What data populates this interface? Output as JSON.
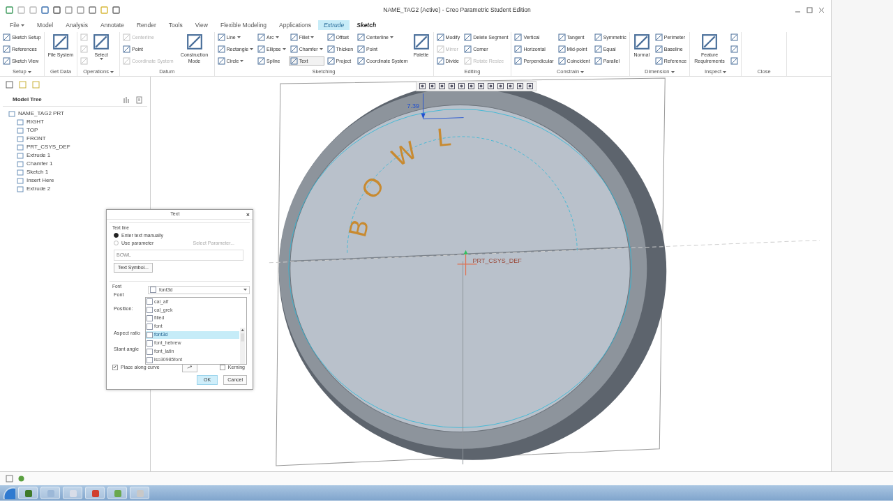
{
  "window": {
    "title": "NAME_TAG2 (Active) - Creo Parametric Student Edition"
  },
  "tabs": [
    {
      "label": "File",
      "dropdown": true,
      "highlighted": false,
      "selected": false
    },
    {
      "label": "Model",
      "dropdown": false,
      "highlighted": false,
      "selected": false
    },
    {
      "label": "Analysis",
      "dropdown": false,
      "highlighted": false,
      "selected": false
    },
    {
      "label": "Annotate",
      "dropdown": false,
      "highlighted": false,
      "selected": false
    },
    {
      "label": "Render",
      "dropdown": false,
      "highlighted": false,
      "selected": false
    },
    {
      "label": "Tools",
      "dropdown": false,
      "highlighted": false,
      "selected": false
    },
    {
      "label": "View",
      "dropdown": false,
      "highlighted": false,
      "selected": false
    },
    {
      "label": "Flexible Modeling",
      "dropdown": false,
      "highlighted": false,
      "selected": false
    },
    {
      "label": "Applications",
      "dropdown": false,
      "highlighted": false,
      "selected": false
    },
    {
      "label": "Extrude",
      "dropdown": false,
      "highlighted": true,
      "selected": false
    },
    {
      "label": "Sketch",
      "dropdown": false,
      "highlighted": false,
      "selected": true
    }
  ],
  "ribbon": [
    {
      "label": "Setup",
      "dropdown": true,
      "columns": [
        [
          {
            "kind": "small",
            "label": "Sketch Setup",
            "disabled": false,
            "dropdown": false,
            "pressed": false
          },
          {
            "kind": "small",
            "label": "References",
            "disabled": false,
            "dropdown": false,
            "pressed": false
          },
          {
            "kind": "small",
            "label": "Sketch View",
            "disabled": false,
            "dropdown": false,
            "pressed": false
          }
        ]
      ]
    },
    {
      "label": "Get Data",
      "dropdown": false,
      "columns": [
        [
          {
            "kind": "large",
            "label": "File System",
            "disabled": false,
            "dropdown": false,
            "pressed": false
          }
        ]
      ]
    },
    {
      "label": "Operations",
      "dropdown": true,
      "columns": [
        [
          {
            "kind": "icon",
            "disabled": true,
            "dropdown": false,
            "pressed": false
          },
          {
            "kind": "icon",
            "disabled": true,
            "dropdown": false,
            "pressed": false
          },
          {
            "kind": "icon",
            "disabled": true,
            "dropdown": false,
            "pressed": false
          }
        ],
        [
          {
            "kind": "large",
            "label": "Select",
            "disabled": false,
            "dropdown": true,
            "pressed": false
          }
        ]
      ]
    },
    {
      "label": "Datum",
      "dropdown": false,
      "columns": [
        [
          {
            "kind": "small",
            "label": "Centerline",
            "disabled": true,
            "dropdown": false,
            "pressed": false
          },
          {
            "kind": "small",
            "label": "Point",
            "disabled": false,
            "dropdown": false,
            "pressed": false
          },
          {
            "kind": "small",
            "label": "Coordinate System",
            "disabled": true,
            "dropdown": false,
            "pressed": false
          }
        ],
        [
          {
            "kind": "large",
            "label": "Construction Mode",
            "disabled": false,
            "dropdown": false,
            "pressed": false
          }
        ]
      ]
    },
    {
      "label": "Sketching",
      "dropdown": false,
      "columns": [
        [
          {
            "kind": "small",
            "label": "Line",
            "disabled": false,
            "dropdown": true,
            "pressed": false
          },
          {
            "kind": "small",
            "label": "Rectangle",
            "disabled": false,
            "dropdown": true,
            "pressed": false
          },
          {
            "kind": "small",
            "label": "Circle",
            "disabled": false,
            "dropdown": true,
            "pressed": false
          }
        ],
        [
          {
            "kind": "small",
            "label": "Arc",
            "disabled": false,
            "dropdown": true,
            "pressed": false
          },
          {
            "kind": "small",
            "label": "Ellipse",
            "disabled": false,
            "dropdown": true,
            "pressed": false
          },
          {
            "kind": "small",
            "label": "Spline",
            "disabled": false,
            "dropdown": false,
            "pressed": false
          }
        ],
        [
          {
            "kind": "small",
            "label": "Fillet",
            "disabled": false,
            "dropdown": true,
            "pressed": false
          },
          {
            "kind": "small",
            "label": "Chamfer",
            "disabled": false,
            "dropdown": true,
            "pressed": false
          },
          {
            "kind": "small",
            "label": "Text",
            "disabled": false,
            "dropdown": false,
            "pressed": true
          }
        ],
        [
          {
            "kind": "small",
            "label": "Offset",
            "disabled": false,
            "dropdown": false,
            "pressed": false
          },
          {
            "kind": "small",
            "label": "Thicken",
            "disabled": false,
            "dropdown": false,
            "pressed": false
          },
          {
            "kind": "small",
            "label": "Project",
            "disabled": false,
            "dropdown": false,
            "pressed": false
          }
        ],
        [
          {
            "kind": "small",
            "label": "Centerline",
            "disabled": false,
            "dropdown": true,
            "pressed": false
          },
          {
            "kind": "small",
            "label": "Point",
            "disabled": false,
            "dropdown": false,
            "pressed": false
          },
          {
            "kind": "small",
            "label": "Coordinate System",
            "disabled": false,
            "dropdown": false,
            "pressed": false
          }
        ],
        [
          {
            "kind": "large",
            "label": "Palette",
            "disabled": false,
            "dropdown": false,
            "pressed": false
          }
        ]
      ]
    },
    {
      "label": "Editing",
      "dropdown": false,
      "columns": [
        [
          {
            "kind": "small",
            "label": "Modify",
            "disabled": false,
            "dropdown": false,
            "pressed": false
          },
          {
            "kind": "small",
            "label": "Mirror",
            "disabled": true,
            "dropdown": false,
            "pressed": false
          },
          {
            "kind": "small",
            "label": "Divide",
            "disabled": false,
            "dropdown": false,
            "pressed": false
          }
        ],
        [
          {
            "kind": "small",
            "label": "Delete Segment",
            "disabled": false,
            "dropdown": false,
            "pressed": false
          },
          {
            "kind": "small",
            "label": "Corner",
            "disabled": false,
            "dropdown": false,
            "pressed": false
          },
          {
            "kind": "small",
            "label": "Rotate Resize",
            "disabled": true,
            "dropdown": false,
            "pressed": false
          }
        ]
      ]
    },
    {
      "label": "Constrain",
      "dropdown": true,
      "columns": [
        [
          {
            "kind": "small",
            "label": "Vertical",
            "disabled": false,
            "dropdown": false,
            "pressed": false
          },
          {
            "kind": "small",
            "label": "Horizontal",
            "disabled": false,
            "dropdown": false,
            "pressed": false
          },
          {
            "kind": "small",
            "label": "Perpendicular",
            "disabled": false,
            "dropdown": false,
            "pressed": false
          }
        ],
        [
          {
            "kind": "small",
            "label": "Tangent",
            "disabled": false,
            "dropdown": false,
            "pressed": false
          },
          {
            "kind": "small",
            "label": "Mid-point",
            "disabled": false,
            "dropdown": false,
            "pressed": false
          },
          {
            "kind": "small",
            "label": "Coincident",
            "disabled": false,
            "dropdown": false,
            "pressed": false
          }
        ],
        [
          {
            "kind": "small",
            "label": "Symmetric",
            "disabled": false,
            "dropdown": false,
            "pressed": false
          },
          {
            "kind": "small",
            "label": "Equal",
            "disabled": false,
            "dropdown": false,
            "pressed": false
          },
          {
            "kind": "small",
            "label": "Parallel",
            "disabled": false,
            "dropdown": false,
            "pressed": false
          }
        ]
      ]
    },
    {
      "label": "Dimension",
      "dropdown": true,
      "columns": [
        [
          {
            "kind": "large",
            "label": "Normal",
            "disabled": false,
            "dropdown": false,
            "pressed": false
          }
        ],
        [
          {
            "kind": "small",
            "label": "Perimeter",
            "disabled": false,
            "dropdown": false,
            "pressed": false
          },
          {
            "kind": "small",
            "label": "Baseline",
            "disabled": false,
            "dropdown": false,
            "pressed": false
          },
          {
            "kind": "small",
            "label": "Reference",
            "disabled": false,
            "dropdown": false,
            "pressed": false
          }
        ]
      ]
    },
    {
      "label": "Inspect",
      "dropdown": true,
      "columns": [
        [
          {
            "kind": "large",
            "label": "Feature Requirements",
            "disabled": false,
            "dropdown": false,
            "pressed": false
          }
        ],
        [
          {
            "kind": "icon",
            "disabled": false,
            "dropdown": false,
            "pressed": false
          },
          {
            "kind": "icon",
            "disabled": false,
            "dropdown": false,
            "pressed": false
          },
          {
            "kind": "icon",
            "disabled": false,
            "dropdown": false,
            "pressed": false
          }
        ]
      ]
    },
    {
      "label": "Close",
      "dropdown": false
    }
  ],
  "model_tree": {
    "title": "Model Tree",
    "items": [
      {
        "label": "NAME_TAG2 PRT",
        "children": [
          {
            "label": "RIGHT"
          },
          {
            "label": "TOP"
          },
          {
            "label": "FRONT"
          },
          {
            "label": "PRT_CSYS_DEF"
          },
          {
            "label": "Extrude 1"
          },
          {
            "label": "Chamfer 1"
          },
          {
            "label": "Sketch 1"
          },
          {
            "label": "Insert Here"
          },
          {
            "label": "Extrude 2"
          }
        ]
      }
    ]
  },
  "canvas": {
    "dimension": "7.39",
    "csys_label": "PRT_CSYS_DEF",
    "sketch_text": "BOWL"
  },
  "text_dialog": {
    "title": "Text",
    "close": "×",
    "text_line": {
      "label": "Text line",
      "options": [
        {
          "label": "Enter text manually",
          "selected": true
        },
        {
          "label": "Use parameter",
          "selected": false
        }
      ],
      "select_parameter": {
        "label": "Select Parameter...",
        "disabled": true
      },
      "value": "BOWL",
      "symbol_button": "Text Symbol..."
    },
    "font": {
      "label": "Font",
      "font_label": "Font",
      "value": "font3d",
      "options": [
        {
          "label": "cal_alf",
          "selected": false
        },
        {
          "label": "cal_grek",
          "selected": false
        },
        {
          "label": "filled",
          "selected": false
        },
        {
          "label": "font",
          "selected": false
        },
        {
          "label": "font3d",
          "selected": true
        },
        {
          "label": "font_hebrew",
          "selected": false
        },
        {
          "label": "font_latin",
          "selected": false
        },
        {
          "label": "iso30985font",
          "selected": false
        }
      ]
    },
    "position_label": "Position:",
    "aspect_ratio_label": "Aspect ratio",
    "slant_angle_label": "Slant angle",
    "place_along_curve": {
      "label": "Place along curve",
      "checked": true
    },
    "kerning": {
      "label": "Kerning",
      "checked": false
    },
    "ok": "OK",
    "cancel": "Cancel"
  }
}
